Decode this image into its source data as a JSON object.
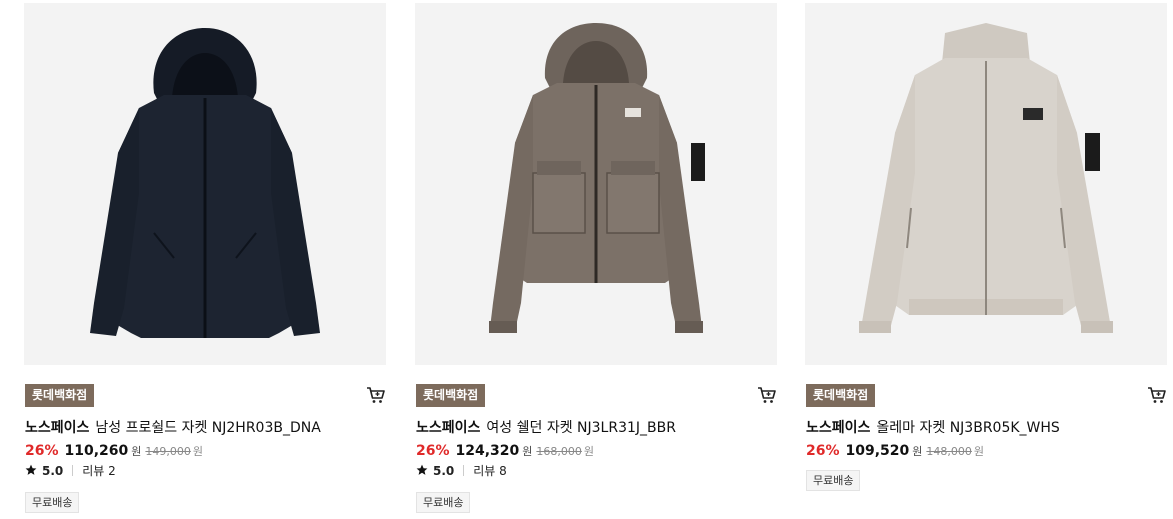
{
  "products": [
    {
      "store": "롯데백화점",
      "brand": "노스페이스",
      "name": "남성 프로쉴드 자켓 NJ2HR03B_DNA",
      "discount": "26%",
      "price": "110,260",
      "currency": "원",
      "original_price": "149,000",
      "rating": "5.0",
      "reviews": "리뷰 2",
      "shipping": "무료배송",
      "image_icon": "jacket-navy-image",
      "color": "#1d2431"
    },
    {
      "store": "롯데백화점",
      "brand": "노스페이스",
      "name": "여성 쉘던 자켓 NJ3LR31J_BBR",
      "discount": "26%",
      "price": "124,320",
      "currency": "원",
      "original_price": "168,000",
      "rating": "5.0",
      "reviews": "리뷰 8",
      "shipping": "무료배송",
      "image_icon": "jacket-brown-image",
      "color": "#7c7168"
    },
    {
      "store": "롯데백화점",
      "brand": "노스페이스",
      "name": "올레마 자켓 NJ3BR05K_WHS",
      "discount": "26%",
      "price": "109,520",
      "currency": "원",
      "original_price": "148,000",
      "shipping": "무료배송",
      "image_icon": "jacket-beige-image",
      "color": "#d8d3cc"
    }
  ],
  "colors": {
    "store_badge": "#7d6b5c",
    "discount": "#e02a2a",
    "thumb_bg": "#f3f3f3"
  }
}
